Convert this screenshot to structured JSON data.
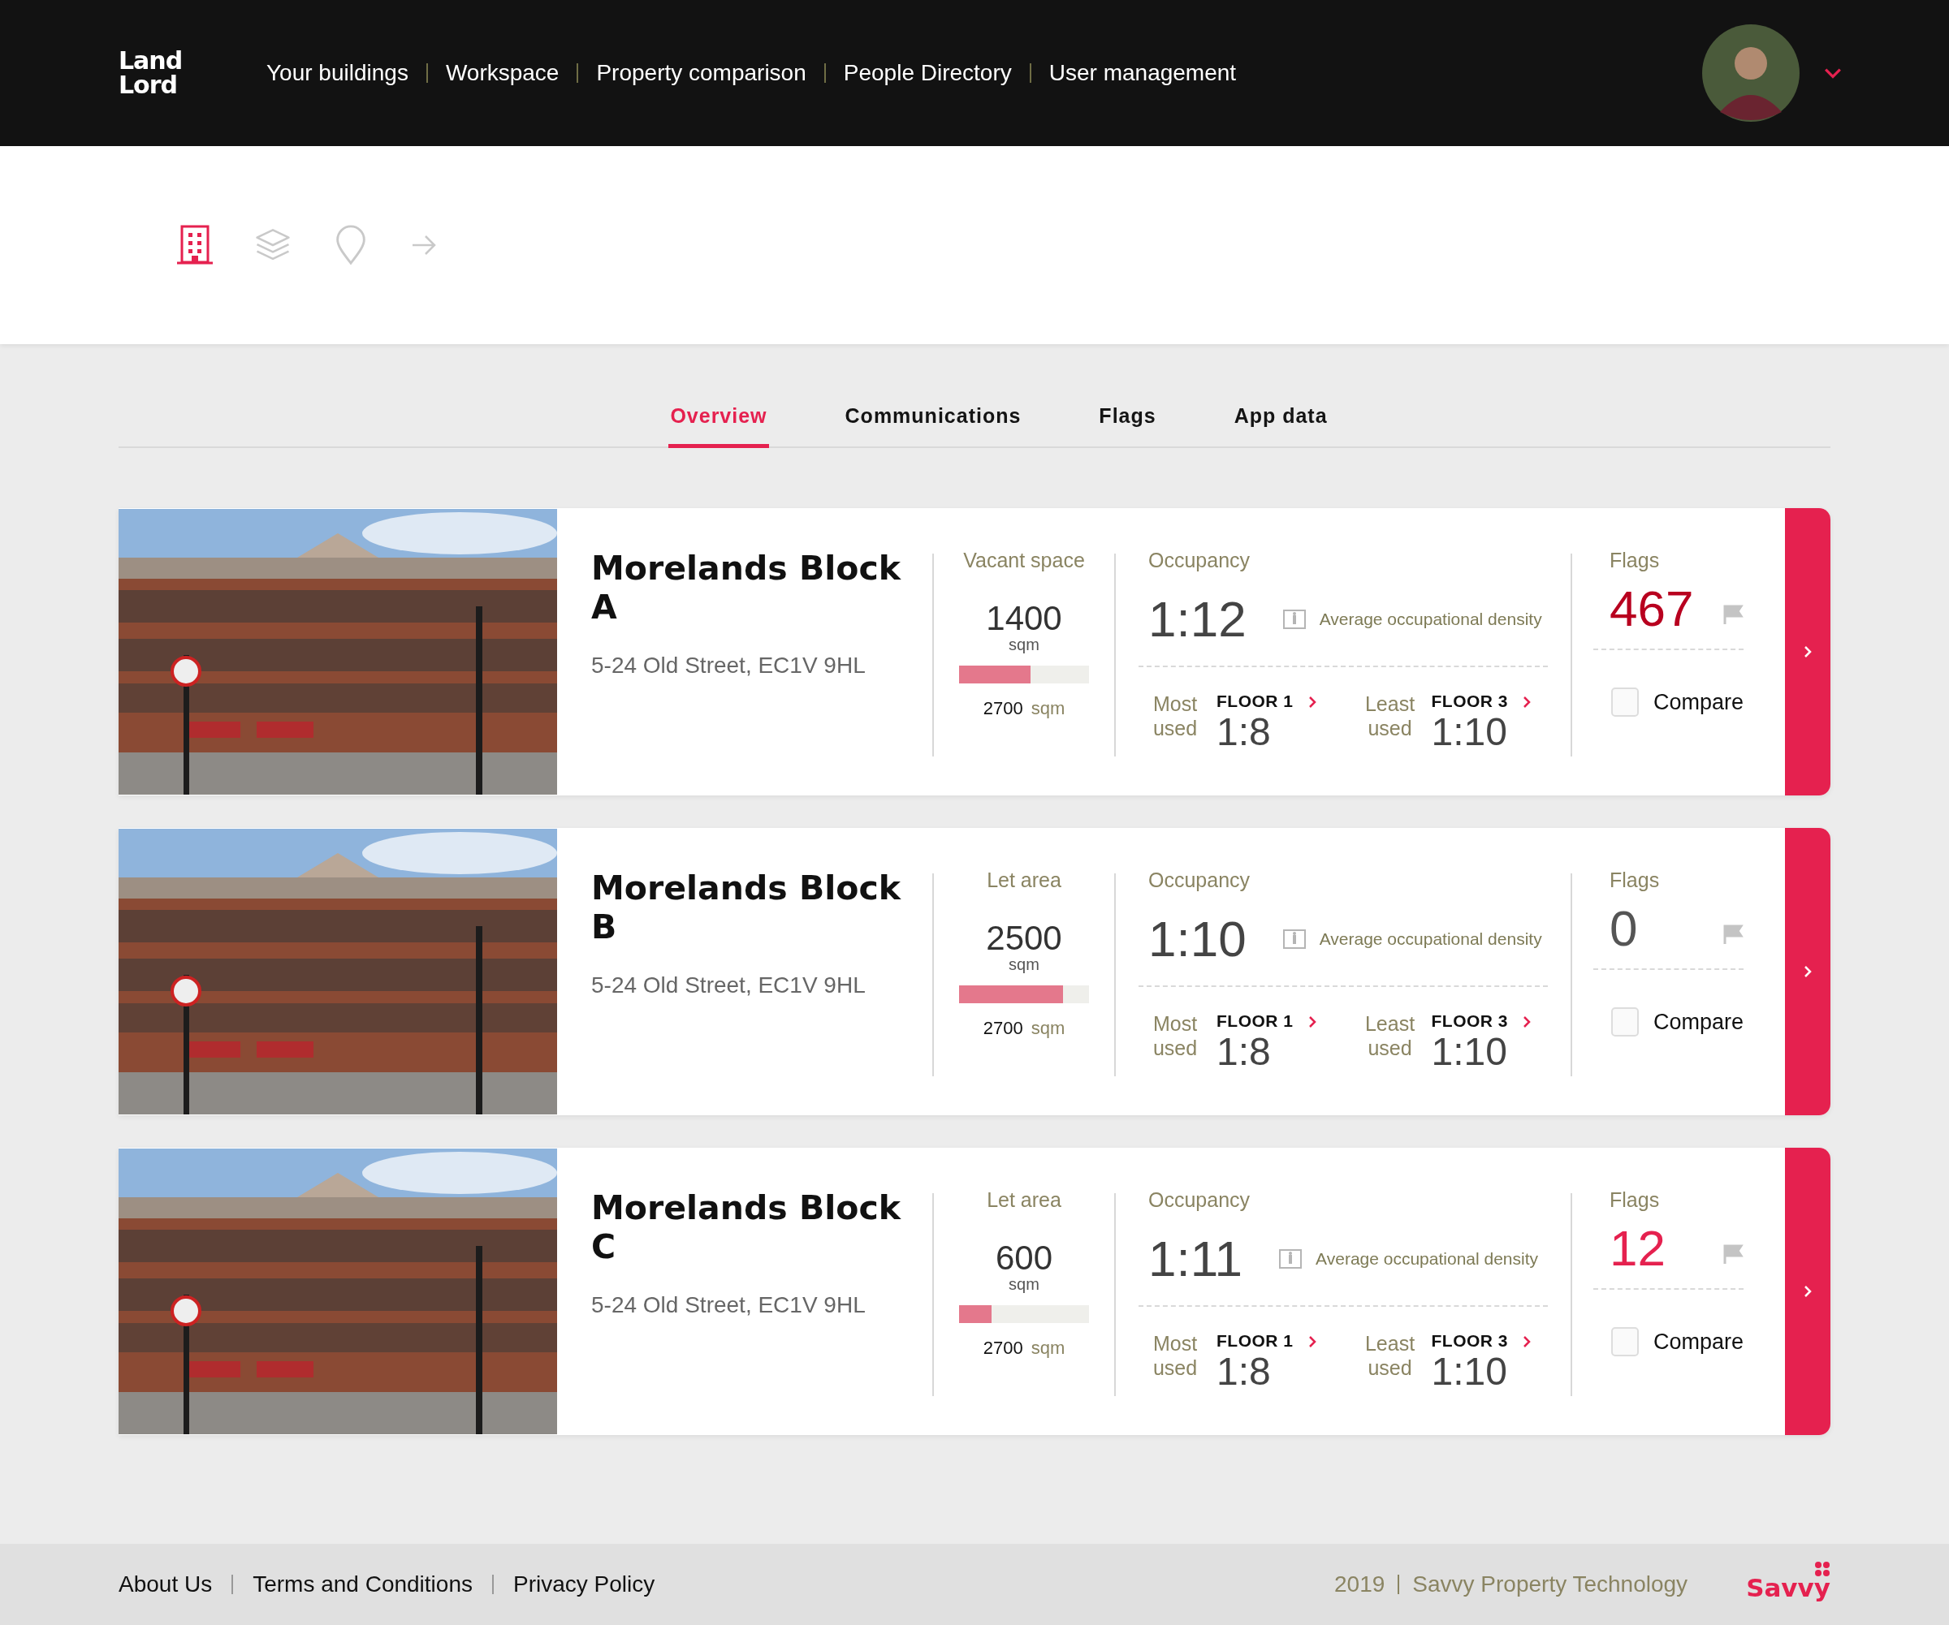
{
  "header": {
    "logo": "Land Lord",
    "nav": [
      "Your buildings",
      "Workspace",
      "Property comparison",
      "People Directory",
      "User management"
    ]
  },
  "view_icons": [
    {
      "kind": "building",
      "selected": true
    },
    {
      "kind": "layers",
      "selected": false
    },
    {
      "kind": "pin",
      "selected": false
    },
    {
      "kind": "arrow",
      "selected": false
    }
  ],
  "tabs": [
    {
      "label": "Overview",
      "selected": true
    },
    {
      "label": "Communications",
      "selected": false
    },
    {
      "label": "Flags",
      "selected": false
    },
    {
      "label": "App data",
      "selected": false
    }
  ],
  "buildings": [
    {
      "name": "Morelands Block A",
      "address": "5-24 Old Street, EC1V 9HL",
      "space_label": "Vacant space",
      "space_value": "1400",
      "space_unit": "sqm",
      "level": 0.55,
      "total": "2700",
      "total_unit": "sqm",
      "occupancy_label": "Occupancy",
      "ratio": "1:12",
      "density_label": "Average occupational density",
      "most_label": "Most used",
      "most_floor": "FLOOR 1",
      "most_ratio": "1:8",
      "least_label": "Least used",
      "least_floor": "FLOOR 3",
      "least_ratio": "1:10",
      "flags_label": "Flags",
      "flags": "467",
      "color": "#b8001f",
      "compare": "Compare",
      "checked": false
    },
    {
      "name": "Morelands Block B",
      "address": "5-24 Old Street, EC1V 9HL",
      "space_label": "Let area",
      "space_value": "2500",
      "space_unit": "sqm",
      "level": 0.8,
      "total": "2700",
      "total_unit": "sqm",
      "occupancy_label": "Occupancy",
      "ratio": "1:10",
      "density_label": "Average occupational density",
      "most_label": "Most used",
      "most_floor": "FLOOR 1",
      "most_ratio": "1:8",
      "least_label": "Least used",
      "least_floor": "FLOOR 3",
      "least_ratio": "1:10",
      "flags_label": "Flags",
      "flags": "0",
      "color": "#555555",
      "compare": "Compare",
      "checked": false
    },
    {
      "name": "Morelands Block C",
      "address": "5-24 Old Street, EC1V 9HL",
      "space_label": "Let area",
      "space_value": "600",
      "space_unit": "sqm",
      "level": 0.25,
      "total": "2700",
      "total_unit": "sqm",
      "occupancy_label": "Occupancy",
      "ratio": "1:11",
      "density_label": "Average occupational density",
      "most_label": "Most used",
      "most_floor": "FLOOR 1",
      "most_ratio": "1:8",
      "least_label": "Least used",
      "least_floor": "FLOOR 3",
      "least_ratio": "1:10",
      "flags_label": "Flags",
      "flags": "12",
      "color": "#e5214f",
      "compare": "Compare",
      "checked": false
    }
  ],
  "footer": {
    "links": [
      "About Us",
      "Terms and Conditions",
      "Privacy Policy"
    ],
    "year": "2019",
    "company": "Savvy Property Technology",
    "logo": "Savvy"
  }
}
